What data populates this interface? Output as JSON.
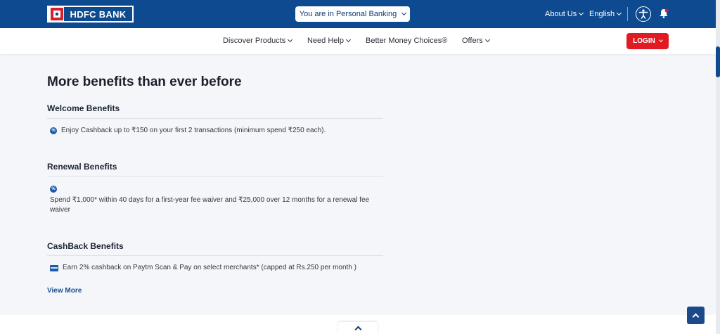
{
  "header": {
    "logo_text": "HDFC BANK",
    "banking_selector": "You are in Personal Banking",
    "about_us": "About Us",
    "language": "English"
  },
  "nav": {
    "items": [
      {
        "label": "Discover Products",
        "has_dropdown": true
      },
      {
        "label": "Need Help",
        "has_dropdown": true
      },
      {
        "label": "Better Money Choices®",
        "has_dropdown": false
      },
      {
        "label": "Offers",
        "has_dropdown": true
      }
    ],
    "login": "LOGIN"
  },
  "main": {
    "title": "More benefits than ever before",
    "sections": [
      {
        "heading": "Welcome Benefits",
        "text": "Enjoy Cashback up to ₹150 on your first 2 transactions (minimum spend ₹250 each).",
        "icon": "percent-badge-icon"
      },
      {
        "heading": "Renewal Benefits",
        "text": "Spend ₹1,000* within 40 days for a first-year fee waiver and ₹25,000 over 12 months for a renewal fee waiver",
        "icon": "percent-badge-icon"
      },
      {
        "heading": "CashBack Benefits",
        "text": "Earn 2% cashback on Paytm Scan & Pay on select merchants* (capped at Rs.250 per month )",
        "icon": "card-icon"
      }
    ],
    "view_more": "View More"
  },
  "icons": {
    "badge_glyph": "%"
  },
  "colors": {
    "brand_blue": "#0e4a8f",
    "login_red": "#e11b22",
    "logo_red": "#d6202b"
  }
}
